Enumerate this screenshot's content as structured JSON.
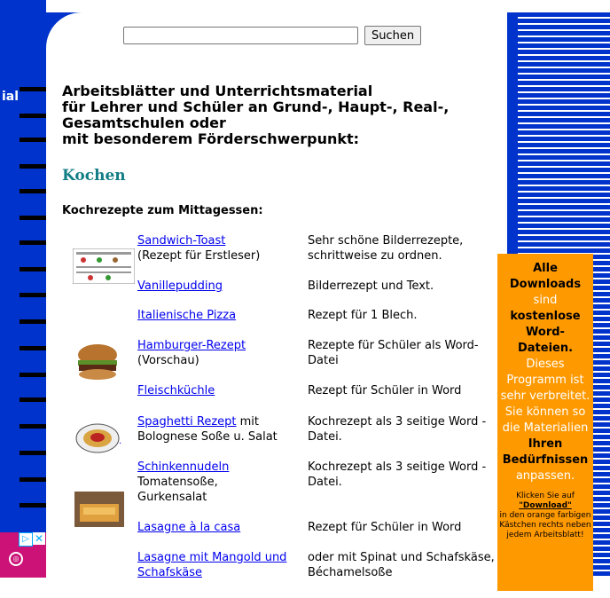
{
  "left_nav": {
    "label": "ial"
  },
  "search": {
    "placeholder": "",
    "value": "",
    "button": "Suchen"
  },
  "heading": [
    "Arbeitsblätter und Unterrichtsmaterial",
    "für Lehrer und Schüler an Grund-, Haupt-, Real-,",
    "Gesamtschulen oder",
    "mit besonderem Förderschwerpunkt:"
  ],
  "section_title": "Kochen",
  "subheading": "Kochrezepte zum Mittagessen:",
  "recipes": [
    {
      "link": "Sandwich-Toast",
      "extra": "(Rezept für Erstleser)",
      "desc": "Sehr schöne Bilderrezepte, schrittweise zu ordnen."
    },
    {
      "link": "Vanillepudding",
      "extra": "",
      "desc": "Bilderrezept und Text."
    },
    {
      "link": "Italienische Pizza",
      "extra": "",
      "desc": "Rezept für 1 Blech."
    },
    {
      "link": "Hamburger-Rezept",
      "extra": "(Vorschau)",
      "desc": "Rezepte für Schüler als Word-Datei"
    },
    {
      "link": "Fleischküchle",
      "extra": "",
      "desc": "Rezept für Schüler in Word"
    },
    {
      "link": "Spaghetti Rezept",
      "extra_inline": " mit",
      "extra": "Bolognese Soße u. Salat",
      "desc": "Kochrezept als 3 seitige Word - Datei."
    },
    {
      "link": "Schinkennudeln",
      "extra": "Tomatensoße, Gurkensalat",
      "desc": "Kochrezept als 3 seitige Word - Datei."
    },
    {
      "link": "Lasagne à la casa",
      "extra": "",
      "desc": "Rezept für Schüler in Word"
    },
    {
      "link": "Lasagne mit Mangold und Schafskäse",
      "extra": "",
      "desc": "oder mit Spinat und Schafskäse, Béchamelsoße"
    }
  ],
  "promo": {
    "l1": "Alle",
    "l2": "Downloads",
    "l3": "sind",
    "l4": "kostenlose",
    "l5": "Word-",
    "l6": "Dateien.",
    "l7": "Dieses Programm ist sehr verbreitet. Sie können so die Materialien",
    "l8": "Ihren Bedürfnissen",
    "l9": "anpassen.",
    "s1": "Klicken Sie auf",
    "s2": "\"Download\"",
    "s3": "in den orange farbigen Kästchen rechts neben jedem Arbeitsblatt!"
  },
  "colors": {
    "brand_blue": "#0033cc",
    "accent_teal": "#127d85",
    "promo_orange": "#ff9900",
    "link": "#0000ee"
  }
}
